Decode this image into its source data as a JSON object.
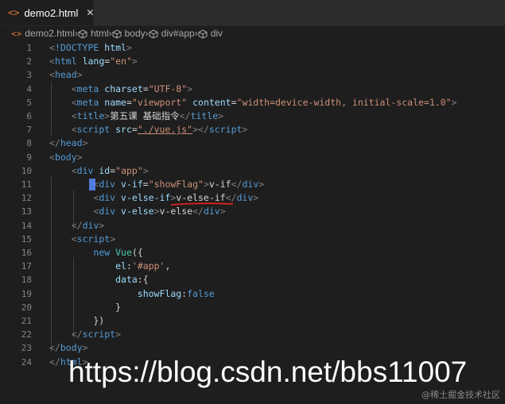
{
  "tab": {
    "icon": "<>",
    "label": "demo2.html",
    "close": "✕"
  },
  "breadcrumb": [
    {
      "label": "demo2.html",
      "icon": "html-file-icon"
    },
    {
      "label": "html",
      "icon": "cube-icon"
    },
    {
      "label": "body",
      "icon": "cube-icon"
    },
    {
      "label": "div#app",
      "icon": "cube-icon"
    },
    {
      "label": "div",
      "icon": "cube-icon"
    }
  ],
  "lines": [
    {
      "n": "1",
      "tokens": [
        [
          "br",
          "<"
        ],
        [
          "tg",
          "!DOCTYPE"
        ],
        [
          "tx",
          " "
        ],
        [
          "at",
          "html"
        ],
        [
          "br",
          ">"
        ]
      ]
    },
    {
      "n": "2",
      "tokens": [
        [
          "br",
          "<"
        ],
        [
          "tg",
          "html"
        ],
        [
          "tx",
          " "
        ],
        [
          "at",
          "lang"
        ],
        [
          "tx",
          "="
        ],
        [
          "st",
          "\"en\""
        ],
        [
          "br",
          ">"
        ]
      ]
    },
    {
      "n": "3",
      "tokens": [
        [
          "br",
          "<"
        ],
        [
          "tg",
          "head"
        ],
        [
          "br",
          ">"
        ]
      ]
    },
    {
      "n": "4",
      "tokens": [
        [
          "tx",
          "    "
        ],
        [
          "br",
          "<"
        ],
        [
          "tg",
          "meta"
        ],
        [
          "tx",
          " "
        ],
        [
          "at",
          "charset"
        ],
        [
          "tx",
          "="
        ],
        [
          "st",
          "\"UTF-8\""
        ],
        [
          "br",
          ">"
        ]
      ]
    },
    {
      "n": "5",
      "tokens": [
        [
          "tx",
          "    "
        ],
        [
          "br",
          "<"
        ],
        [
          "tg",
          "meta"
        ],
        [
          "tx",
          " "
        ],
        [
          "at",
          "name"
        ],
        [
          "tx",
          "="
        ],
        [
          "st",
          "\"viewport\""
        ],
        [
          "tx",
          " "
        ],
        [
          "at",
          "content"
        ],
        [
          "tx",
          "="
        ],
        [
          "st",
          "\"width=device-width, initial-scale=1.0\""
        ],
        [
          "br",
          ">"
        ]
      ]
    },
    {
      "n": "6",
      "tokens": [
        [
          "tx",
          "    "
        ],
        [
          "br",
          "<"
        ],
        [
          "tg",
          "title"
        ],
        [
          "br",
          ">"
        ],
        [
          "tx",
          "第五课 基础指令"
        ],
        [
          "br",
          "</"
        ],
        [
          "tg",
          "title"
        ],
        [
          "br",
          ">"
        ]
      ]
    },
    {
      "n": "7",
      "tokens": [
        [
          "tx",
          "    "
        ],
        [
          "br",
          "<"
        ],
        [
          "tg",
          "script"
        ],
        [
          "tx",
          " "
        ],
        [
          "at",
          "src"
        ],
        [
          "tx",
          "="
        ],
        [
          "st",
          "\"./vue.js\""
        ],
        [
          "br",
          "></"
        ],
        [
          "tg",
          "script"
        ],
        [
          "br",
          ">"
        ]
      ]
    },
    {
      "n": "8",
      "tokens": [
        [
          "br",
          "</"
        ],
        [
          "tg",
          "head"
        ],
        [
          "br",
          ">"
        ]
      ]
    },
    {
      "n": "9",
      "tokens": [
        [
          "br",
          "<"
        ],
        [
          "tg",
          "body"
        ],
        [
          "br",
          ">"
        ]
      ]
    },
    {
      "n": "10",
      "tokens": [
        [
          "tx",
          "    "
        ],
        [
          "br",
          "<"
        ],
        [
          "tg",
          "div"
        ],
        [
          "tx",
          " "
        ],
        [
          "at",
          "id"
        ],
        [
          "tx",
          "="
        ],
        [
          "st",
          "\"app\""
        ],
        [
          "br",
          ">"
        ]
      ]
    },
    {
      "n": "11",
      "tokens": [
        [
          "tx",
          "        "
        ],
        [
          "br",
          "<"
        ],
        [
          "tg",
          "div"
        ],
        [
          "tx",
          " "
        ],
        [
          "at",
          "v-if"
        ],
        [
          "tx",
          "="
        ],
        [
          "st",
          "\"showFlag\""
        ],
        [
          "br",
          ">"
        ],
        [
          "tx",
          "v-if"
        ],
        [
          "br",
          "</"
        ],
        [
          "tg",
          "div"
        ],
        [
          "br",
          ">"
        ]
      ]
    },
    {
      "n": "12",
      "tokens": [
        [
          "tx",
          "        "
        ],
        [
          "br",
          "<"
        ],
        [
          "tg",
          "div"
        ],
        [
          "tx",
          " "
        ],
        [
          "at",
          "v-else-if"
        ],
        [
          "br",
          ">"
        ],
        [
          "tx",
          "v-else-if"
        ],
        [
          "br",
          "</"
        ],
        [
          "tg",
          "div"
        ],
        [
          "br",
          ">"
        ]
      ]
    },
    {
      "n": "13",
      "tokens": [
        [
          "tx",
          "        "
        ],
        [
          "br",
          "<"
        ],
        [
          "tg",
          "div"
        ],
        [
          "tx",
          " "
        ],
        [
          "at",
          "v-else"
        ],
        [
          "br",
          ">"
        ],
        [
          "tx",
          "v-else"
        ],
        [
          "br",
          "</"
        ],
        [
          "tg",
          "div"
        ],
        [
          "br",
          ">"
        ]
      ]
    },
    {
      "n": "14",
      "tokens": [
        [
          "tx",
          "    "
        ],
        [
          "br",
          "</"
        ],
        [
          "tg",
          "div"
        ],
        [
          "br",
          ">"
        ]
      ]
    },
    {
      "n": "15",
      "tokens": [
        [
          "tx",
          "    "
        ],
        [
          "br",
          "<"
        ],
        [
          "tg",
          "script"
        ],
        [
          "br",
          ">"
        ]
      ]
    },
    {
      "n": "16",
      "tokens": [
        [
          "tx",
          "        "
        ],
        [
          "ky",
          "new"
        ],
        [
          "tx",
          " "
        ],
        [
          "fn",
          "Vue"
        ],
        [
          "tx",
          "({"
        ]
      ]
    },
    {
      "n": "17",
      "tokens": [
        [
          "tx",
          "            "
        ],
        [
          "pr",
          "el"
        ],
        [
          "tx",
          ":"
        ],
        [
          "st",
          "'#app'"
        ],
        [
          "tx",
          ","
        ]
      ]
    },
    {
      "n": "18",
      "tokens": [
        [
          "tx",
          "            "
        ],
        [
          "pr",
          "data"
        ],
        [
          "tx",
          ":{"
        ]
      ]
    },
    {
      "n": "19",
      "tokens": [
        [
          "tx",
          "                "
        ],
        [
          "pr",
          "showFlag"
        ],
        [
          "tx",
          ":"
        ],
        [
          "bl",
          "false"
        ]
      ]
    },
    {
      "n": "20",
      "tokens": [
        [
          "tx",
          "            }"
        ]
      ]
    },
    {
      "n": "21",
      "tokens": [
        [
          "tx",
          "        })"
        ]
      ]
    },
    {
      "n": "22",
      "tokens": [
        [
          "tx",
          "    "
        ],
        [
          "br",
          "</"
        ],
        [
          "tg",
          "script"
        ],
        [
          "br",
          ">"
        ]
      ]
    },
    {
      "n": "23",
      "tokens": [
        [
          "br",
          "</"
        ],
        [
          "tg",
          "body"
        ],
        [
          "br",
          ">"
        ]
      ]
    },
    {
      "n": "24",
      "tokens": [
        [
          "br",
          "</"
        ],
        [
          "tg",
          "html"
        ],
        [
          "br",
          ">"
        ]
      ]
    }
  ],
  "watermark": "https://blog.csdn.net/bbs11007",
  "watermark_small": "@稀土掘金技术社区",
  "colors": {
    "background": "#1e1e1e",
    "tag": "#569cd6",
    "attribute": "#9cdcfe",
    "string": "#ce9178",
    "class": "#4ec9b0",
    "annotation_underline": "#e02020"
  }
}
